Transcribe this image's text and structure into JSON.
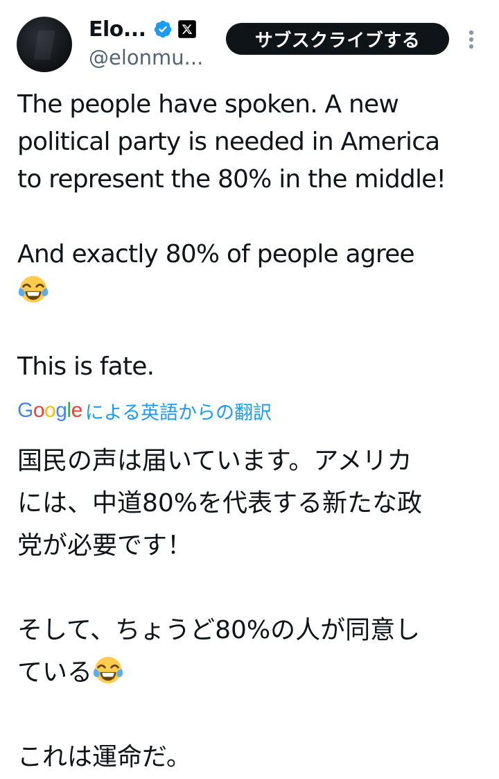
{
  "author": {
    "display_name": "Elo...",
    "handle": "@elonmu...",
    "verified_icon": "verified-badge-icon",
    "affiliation_icon": "x-logo-icon"
  },
  "header": {
    "subscribe_label": "サブスクライブする",
    "more_icon": "more-vertical-icon"
  },
  "tweet": {
    "lines": [
      "The people have spoken. A new",
      "political party is needed in America",
      "to represent the 80% in the middle!",
      "",
      "And exactly 80% of people agree",
      "",
      "",
      "This is fate."
    ]
  },
  "translation": {
    "provider": "Google",
    "label": "による英語からの翻訳",
    "lines": [
      "国民の声は届いています。アメリカ",
      "には、中道80%を代表する新たな政",
      "党が必要です！",
      "",
      "そして、ちょうど80%の人が同意し",
      "ている",
      "",
      "これは運命だ。"
    ]
  },
  "colors": {
    "accent": "#1d9bf0",
    "text": "#0f1419",
    "secondary": "#536471",
    "button_bg": "#0f1419"
  }
}
